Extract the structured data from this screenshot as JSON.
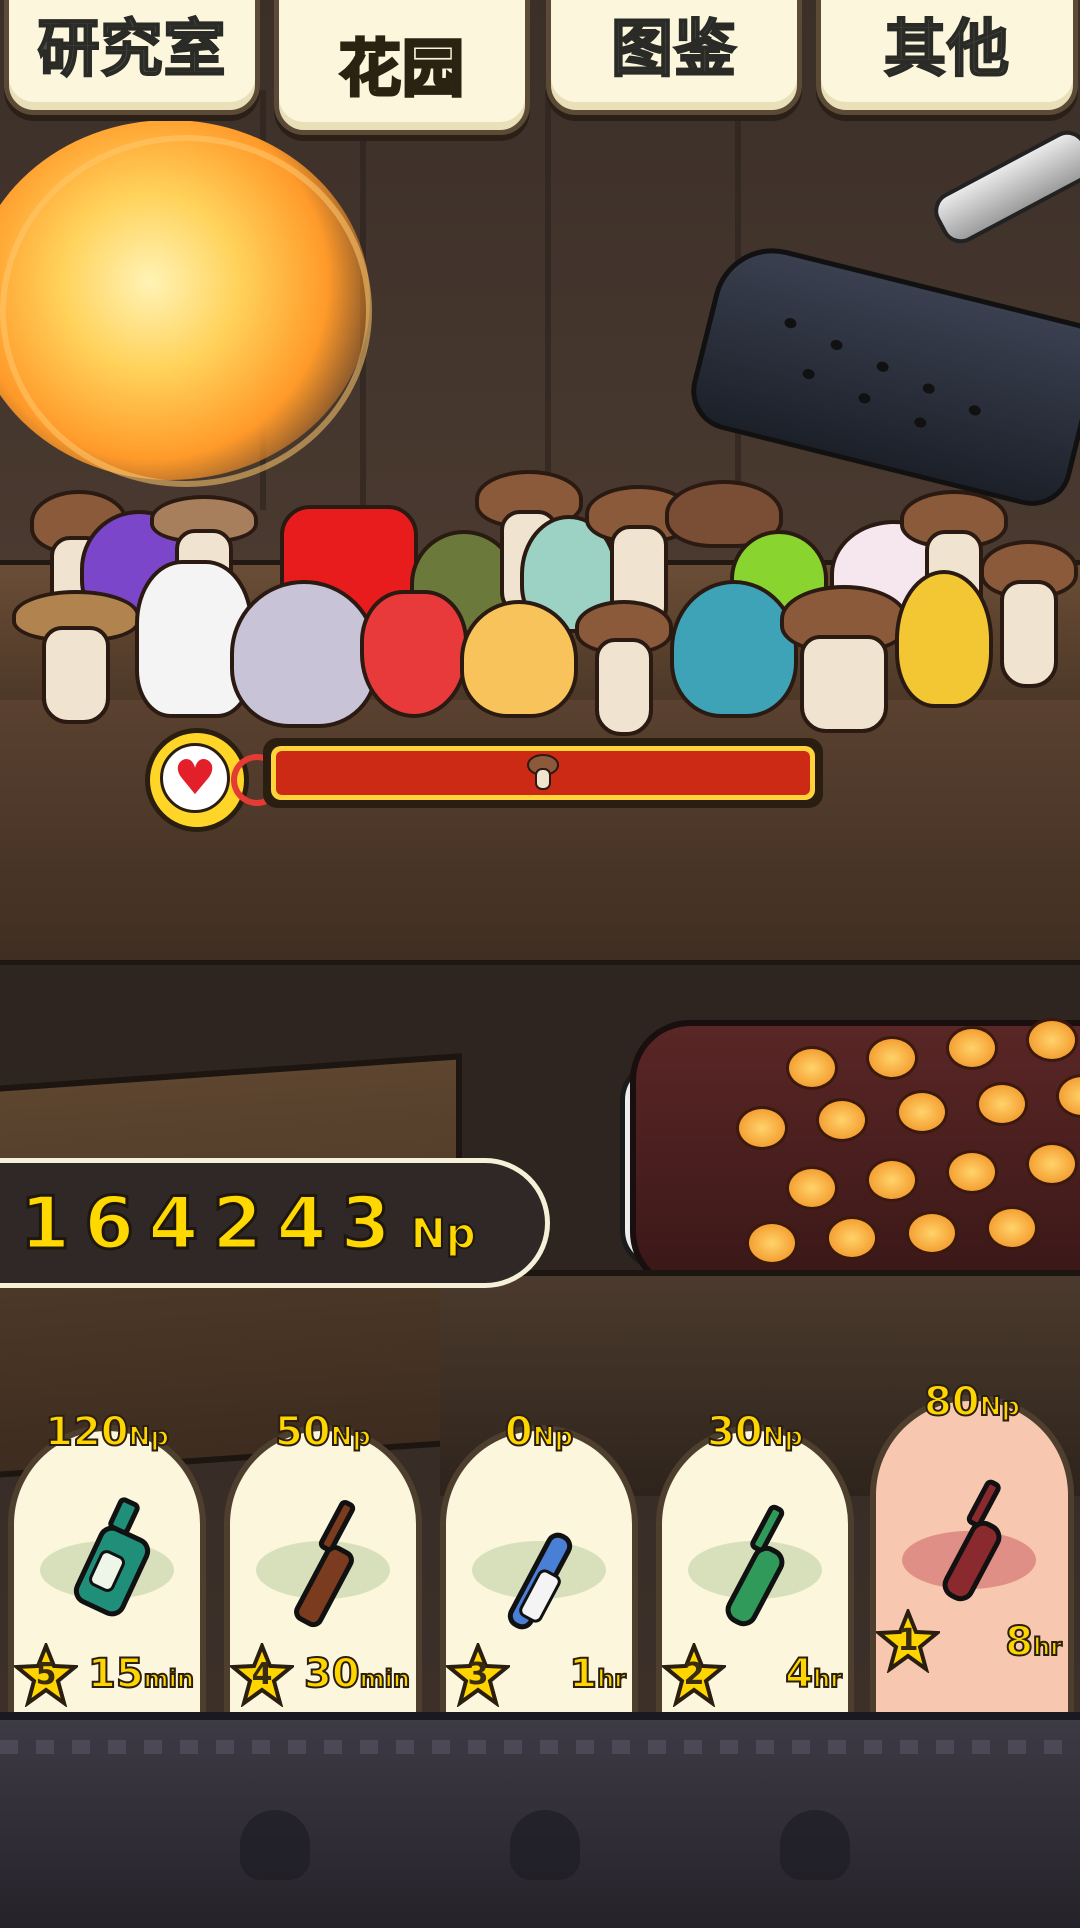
{
  "tabs": [
    {
      "label": "研究室",
      "active": false
    },
    {
      "label": "花园",
      "active": true
    },
    {
      "label": "图鉴",
      "active": false
    },
    {
      "label": "其他",
      "active": false
    }
  ],
  "points": {
    "value": "164243",
    "unit": "Np"
  },
  "health": {
    "icon": "heart-icon"
  },
  "cards": [
    {
      "price": "120",
      "price_unit": "Np",
      "stars": "5",
      "time": "15",
      "time_unit": "min",
      "bottle_color": "#1f8f7a",
      "selected": false
    },
    {
      "price": "50",
      "price_unit": "Np",
      "stars": "4",
      "time": "30",
      "time_unit": "min",
      "bottle_color": "#7a3b1e",
      "selected": false
    },
    {
      "price": "0",
      "price_unit": "Np",
      "stars": "3",
      "time": "1",
      "time_unit": "hr",
      "bottle_color": "#4a7fd6",
      "selected": false
    },
    {
      "price": "30",
      "price_unit": "Np",
      "stars": "2",
      "time": "4",
      "time_unit": "hr",
      "bottle_color": "#2f9a5a",
      "selected": false
    },
    {
      "price": "80",
      "price_unit": "Np",
      "stars": "1",
      "time": "8",
      "time_unit": "hr",
      "bottle_color": "#8a2a2e",
      "selected": true
    }
  ],
  "colors": {
    "accent": "#ffd500",
    "bar_fill": "#cc2a14",
    "card_bg": "#fbf6dc",
    "card_selected_bg": "#f8c7b0"
  }
}
